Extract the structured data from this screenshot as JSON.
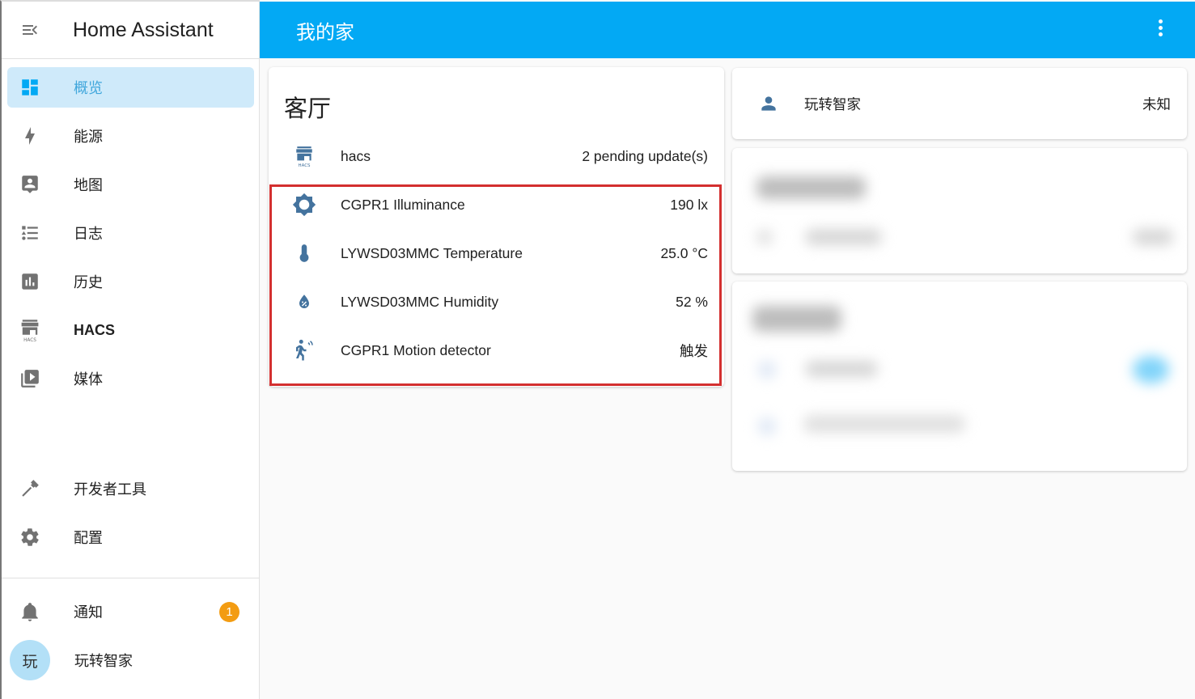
{
  "app": {
    "title": "Home Assistant"
  },
  "sidebar": {
    "items": [
      {
        "label": "概览",
        "icon": "dashboard-icon",
        "active": true
      },
      {
        "label": "能源",
        "icon": "lightning-bolt-icon"
      },
      {
        "label": "地图",
        "icon": "map-account-icon"
      },
      {
        "label": "日志",
        "icon": "logbook-list-icon"
      },
      {
        "label": "历史",
        "icon": "chart-box-icon"
      },
      {
        "label": "HACS",
        "icon": "hacs-store-icon"
      },
      {
        "label": "媒体",
        "icon": "media-play-icon"
      }
    ],
    "tools": [
      {
        "label": "开发者工具",
        "icon": "hammer-icon"
      },
      {
        "label": "配置",
        "icon": "gear-icon"
      }
    ],
    "notifications": {
      "label": "通知",
      "icon": "bell-icon",
      "count": "1"
    },
    "user": {
      "label": "玩转智家",
      "avatar_text": "玩"
    }
  },
  "topbar": {
    "title": "我的家",
    "menu_icon": "dots-vertical-icon"
  },
  "cards": {
    "living_room": {
      "title": "客厅",
      "entities": [
        {
          "name": "hacs",
          "state": "2 pending update(s)",
          "icon": "hacs-store-icon"
        },
        {
          "name": "CGPR1 Illuminance",
          "state": "190 lx",
          "icon": "brightness-icon"
        },
        {
          "name": "LYWSD03MMC Temperature",
          "state": "25.0 °C",
          "icon": "thermometer-icon"
        },
        {
          "name": "LYWSD03MMC Humidity",
          "state": "52 %",
          "icon": "water-percent-icon"
        },
        {
          "name": "CGPR1 Motion detector",
          "state": "触发",
          "icon": "motion-sensor-icon"
        }
      ]
    },
    "person": {
      "name": "玩转智家",
      "state": "未知",
      "icon": "account-icon"
    }
  },
  "colors": {
    "primary": "#03a9f4",
    "icon_blue": "#44739e",
    "sidebar_icon": "#727272",
    "active_bg": "#cfeafa",
    "badge": "#f39c12",
    "highlight": "#d32f2f"
  }
}
